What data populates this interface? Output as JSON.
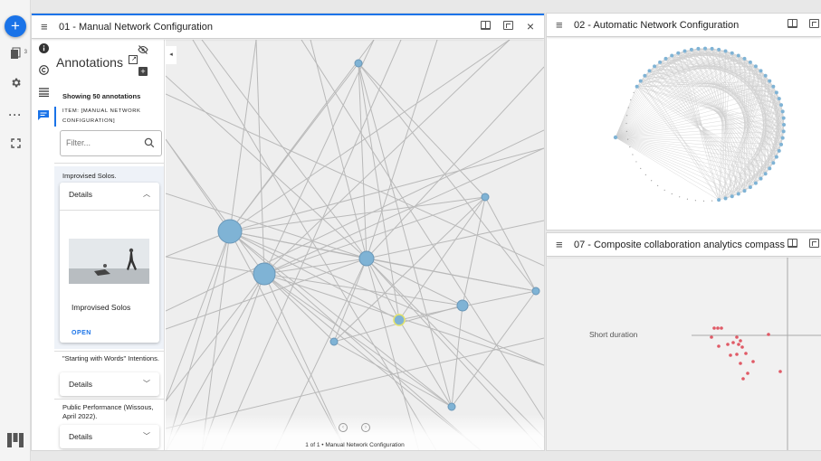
{
  "app": {
    "new_button": "+",
    "rail_icons": [
      "books-icon",
      "gear-icon",
      "more-icon",
      "fullscreen-icon"
    ],
    "rail_badge": "3"
  },
  "window1": {
    "title": "01 - Manual Network Configuration",
    "close": "×",
    "annotations": {
      "title": "Annotations",
      "showing": "Showing 50 annotations",
      "item_label": "ITEM: [MANUAL NETWORK CONFIGURATION]",
      "filter_placeholder": "Filter...",
      "entries": [
        {
          "text": "Improvised Solos.",
          "details_label": "Details",
          "card_title": "Improvised Solos",
          "open_label": "OPEN"
        },
        {
          "text": "\"Starting with Words\" Intentions.",
          "details_label": "Details"
        },
        {
          "text": "Public Performance (Wissous, April 2022).",
          "details_label": "Details"
        }
      ]
    },
    "pager": {
      "text": "1 of 1 • Manual Network Configuration"
    },
    "graph_accent": "#7fb3d5",
    "highlight_color": "#e3e36a"
  },
  "window2": {
    "title": "02 - Automatic Network Configuration"
  },
  "window3": {
    "title": "07 - Composite collaboration analytics compass",
    "label": "Short duration",
    "dot_color": "#e05a66"
  },
  "colors": {
    "accent": "#1a73e8"
  }
}
